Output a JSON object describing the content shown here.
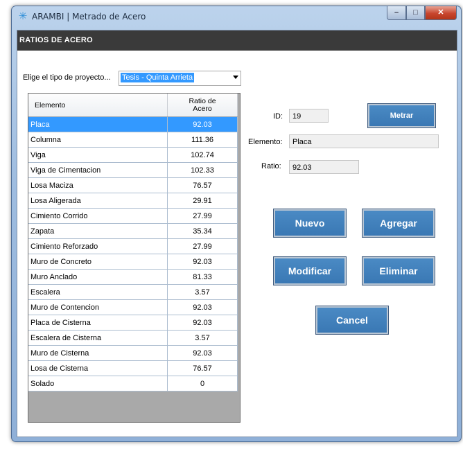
{
  "window": {
    "title": "ARAMBI | Metrado de Acero",
    "icon": "snowflake-icon"
  },
  "header": {
    "title": "RATIOS DE ACERO"
  },
  "project": {
    "label": "Elige el tipo de proyecto...",
    "selected": "Tesis - Quinta Arrieta"
  },
  "grid": {
    "columns": {
      "element": "Elemento",
      "ratio_line1": "Ratio de",
      "ratio_line2": "Acero"
    },
    "rows": [
      {
        "element": "Placa",
        "ratio": "92.03"
      },
      {
        "element": "Columna",
        "ratio": "111.36"
      },
      {
        "element": "Viga",
        "ratio": "102.74"
      },
      {
        "element": "Viga de Cimentacion",
        "ratio": "102.33"
      },
      {
        "element": "Losa Maciza",
        "ratio": "76.57"
      },
      {
        "element": "Losa Aligerada",
        "ratio": "29.91"
      },
      {
        "element": "Cimiento Corrido",
        "ratio": "27.99"
      },
      {
        "element": "Zapata",
        "ratio": "35.34"
      },
      {
        "element": "Cimiento Reforzado",
        "ratio": "27.99"
      },
      {
        "element": "Muro de Concreto",
        "ratio": "92.03"
      },
      {
        "element": "Muro Anclado",
        "ratio": "81.33"
      },
      {
        "element": "Escalera",
        "ratio": "3.57"
      },
      {
        "element": "Muro de Contencion",
        "ratio": "92.03"
      },
      {
        "element": "Placa de Cisterna",
        "ratio": "92.03"
      },
      {
        "element": "Escalera de Cisterna",
        "ratio": "3.57"
      },
      {
        "element": "Muro de Cisterna",
        "ratio": "92.03"
      },
      {
        "element": "Losa de Cisterna",
        "ratio": "76.57"
      },
      {
        "element": "Solado",
        "ratio": "0"
      }
    ],
    "selected_index": 0
  },
  "detail": {
    "id_label": "ID:",
    "id_value": "19",
    "element_label": "Elemento:",
    "element_value": "Placa",
    "ratio_label": "Ratio:",
    "ratio_value": "92.03"
  },
  "buttons": {
    "metrar": "Metrar",
    "nuevo": "Nuevo",
    "agregar": "Agregar",
    "modificar": "Modificar",
    "eliminar": "Eliminar",
    "cancel": "Cancel"
  },
  "caption_buttons": {
    "minimize": "–",
    "maximize": "□",
    "close": "✕"
  },
  "colors": {
    "selection": "#3399ff",
    "button": "#3f7fbd",
    "header": "#3a3a3a"
  }
}
